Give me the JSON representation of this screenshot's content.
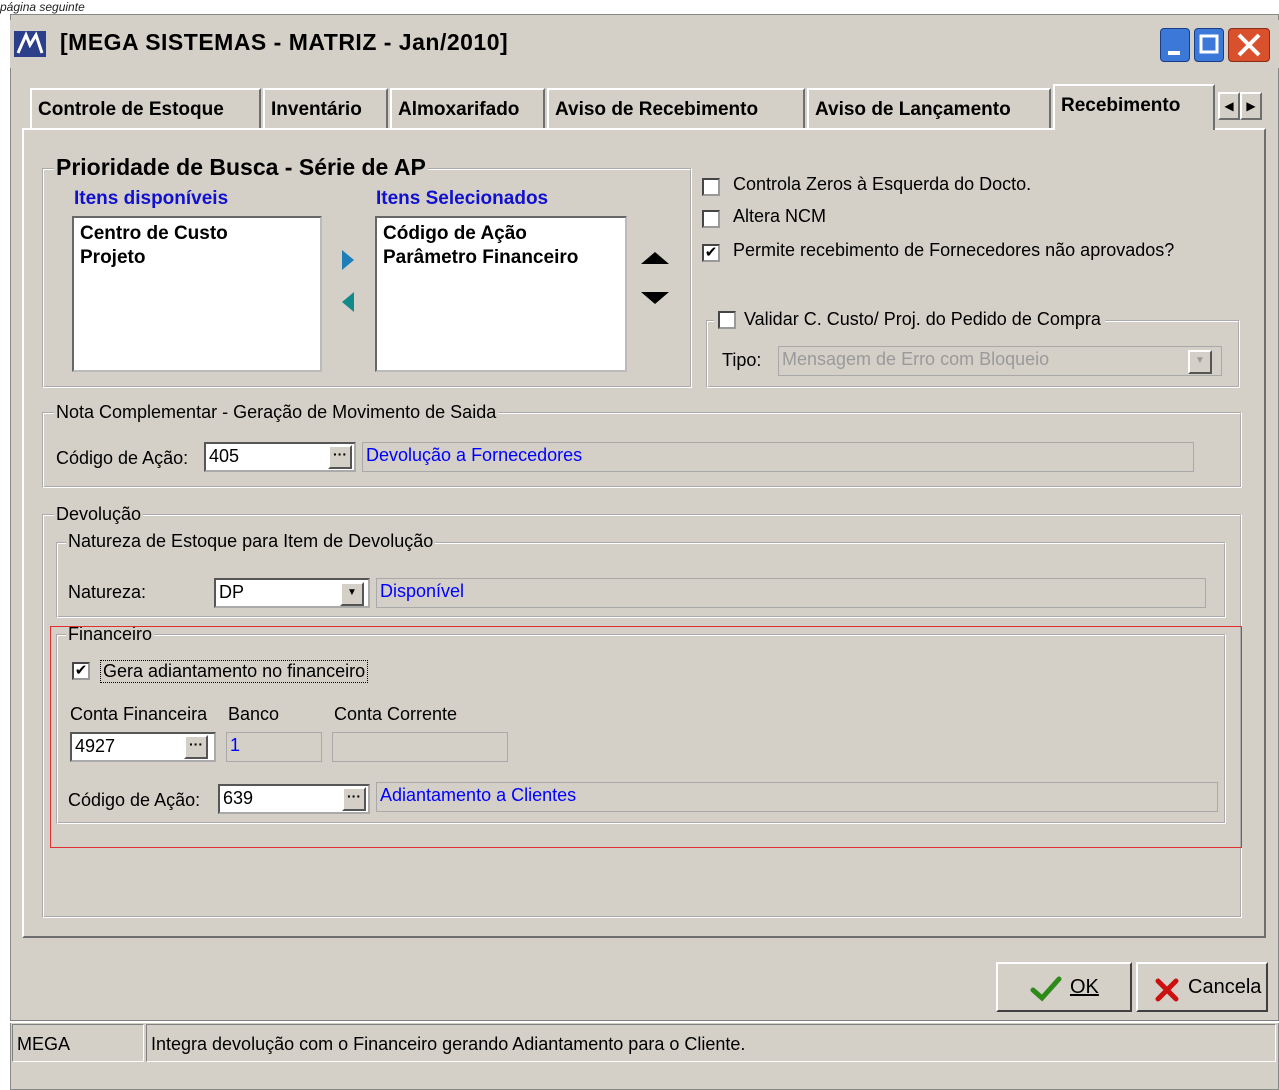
{
  "caption": "página seguinte",
  "window": {
    "title": "[MEGA SISTEMAS - MATRIZ - Jan/2010]"
  },
  "tabs": [
    {
      "label": "Controle de Estoque"
    },
    {
      "label": "Inventário"
    },
    {
      "label": "Almoxarifado"
    },
    {
      "label": "Aviso de Recebimento"
    },
    {
      "label": "Aviso de Lançamento"
    },
    {
      "label": "Recebimento"
    }
  ],
  "prioridade": {
    "title": "Prioridade de Busca - Série de AP",
    "available_header": "Itens disponíveis",
    "selected_header": "Itens Selecionados",
    "available_items": [
      "Centro de Custo",
      "Projeto"
    ],
    "selected_items": [
      "Código de Ação",
      "Parâmetro Financeiro"
    ]
  },
  "options": {
    "controla_zeros": {
      "label": "Controla Zeros à Esquerda do Docto.",
      "checked": false
    },
    "altera_ncm": {
      "label": "Altera NCM",
      "checked": false
    },
    "permite_recebimento": {
      "label": "Permite recebimento de Fornecedores não aprovados?",
      "checked": true
    },
    "validar": {
      "label": "Validar C. Custo/ Proj. do Pedido de Compra",
      "checked": false
    },
    "tipo_label": "Tipo:",
    "tipo_value": "Mensagem de Erro com Bloqueio"
  },
  "nota": {
    "title": "Nota Complementar - Geração de Movimento de Saida",
    "codigo_label": "Código de Ação:",
    "codigo_value": "405",
    "codigo_desc": "Devolução a Fornecedores"
  },
  "devolucao": {
    "title": "Devolução",
    "natureza_group": "Natureza de Estoque para Item de Devolução",
    "natureza_label": "Natureza:",
    "natureza_value": "DP",
    "natureza_desc": "Disponível",
    "financeiro": {
      "title": "Financeiro",
      "gera_label": "Gera adiantamento no financeiro",
      "gera_checked": true,
      "conta_label": "Conta Financeira",
      "banco_label": "Banco",
      "corrente_label": "Conta Corrente",
      "conta_value": "4927",
      "banco_value": "1",
      "corrente_value": "",
      "codigo_label": "Código de Ação:",
      "codigo_value": "639",
      "codigo_desc": "Adiantamento a Clientes"
    }
  },
  "buttons": {
    "ok": "OK",
    "cancel": "Cancela"
  },
  "status": {
    "left": "MEGA",
    "message": "Integra devolução com o Financeiro gerando Adiantamento para o Cliente."
  },
  "colors": {
    "highlight_box": "#e03030",
    "link_blue": "#0000ff"
  }
}
